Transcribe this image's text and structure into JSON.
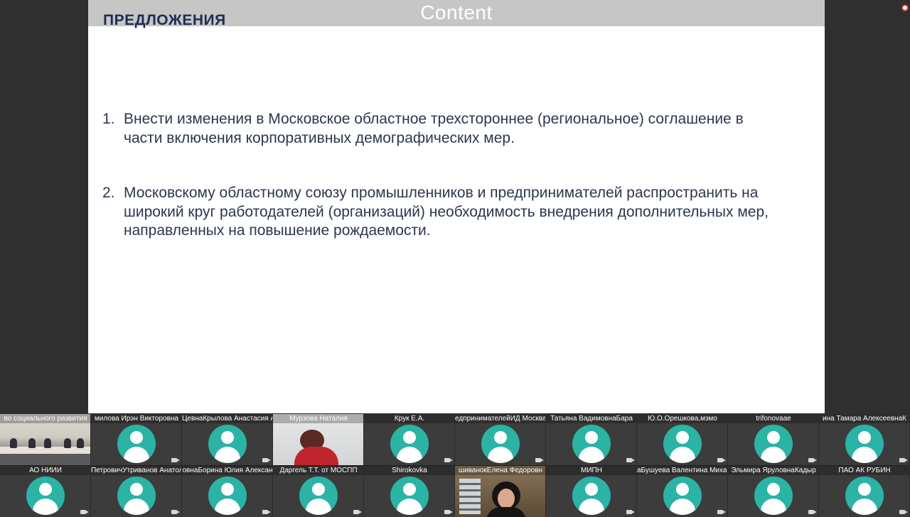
{
  "slide": {
    "content_label": "Content",
    "title": "ПРЕДЛОЖЕНИЯ",
    "items": [
      {
        "num": "1.",
        "text": "Внести изменения в Московское областное трехстороннее (региональное) соглашение в части включения  корпоративных  демографических мер."
      },
      {
        "num": "2.",
        "text": "Московскому областному союзу промышленников и предпринимателей распространить на широкий круг работодателей (организаций) необходимость внедрения дополнительных мер, направленных на повышение рождаемости."
      }
    ]
  },
  "participants": {
    "row1": [
      {
        "name": "во социального развития",
        "kind": "video-room"
      },
      {
        "name": "милова Ирэн Викторовна",
        "kind": "avatar"
      },
      {
        "name": "ЦевнаКрылова Анастасия А",
        "kind": "avatar"
      },
      {
        "name": "Мурзова Наталия",
        "kind": "video-woman"
      },
      {
        "name": "Крук Е.А.",
        "kind": "avatar"
      },
      {
        "name": "едпринимателейИД Москва",
        "kind": "avatar"
      },
      {
        "name": "Татьяна ВадимовнаБара",
        "kind": "avatar"
      },
      {
        "name": "Ю.О.Орешкова,мзмо",
        "kind": "avatar"
      },
      {
        "name": "trifonovaae",
        "kind": "avatar"
      },
      {
        "name": "ина Тамара АлексеевнаК",
        "kind": "avatar"
      }
    ],
    "row2": [
      {
        "name": "АО НИИИ",
        "kind": "avatar"
      },
      {
        "name": "ПетровичУтриванов Анатол",
        "kind": "avatar"
      },
      {
        "name": "овнаБорина Юлия Алексан",
        "kind": "avatar"
      },
      {
        "name": "Даргель Т.Т. от МОСПП",
        "kind": "avatar"
      },
      {
        "name": "Shirokovka",
        "kind": "avatar"
      },
      {
        "name": "шиванокЕлена Федоровн",
        "kind": "video-office"
      },
      {
        "name": "МИПН",
        "kind": "avatar"
      },
      {
        "name": "аБушуева Валентина Михаи",
        "kind": "avatar"
      },
      {
        "name": "Эльмира ЯруловнаКадыр",
        "kind": "avatar"
      },
      {
        "name": "ПАО АК РУБИН",
        "kind": "avatar"
      }
    ]
  },
  "icons": {
    "camera": "video-camera-icon",
    "recording": "record-indicator-icon"
  },
  "colors": {
    "title": "#1f2d55",
    "body_text": "#2d3650",
    "avatar": "#2bb3a5",
    "content_bar": "#c6c6c6"
  }
}
